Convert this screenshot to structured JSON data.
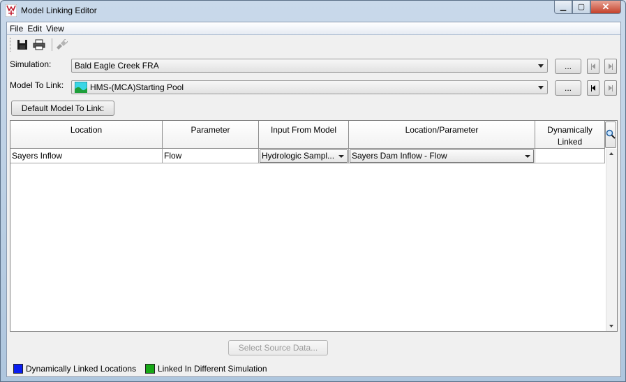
{
  "window": {
    "title": "Model Linking Editor"
  },
  "menubar": {
    "items": [
      "File",
      "Edit",
      "View"
    ]
  },
  "toolbar": {
    "icons": [
      "save-icon",
      "print-icon",
      "plugin-icon"
    ]
  },
  "simulation": {
    "label": "Simulation:",
    "value": "Bald Eagle Creek FRA",
    "browse_label": "..."
  },
  "model_to_link": {
    "label": "Model To Link:",
    "value": "HMS-(MCA)Starting Pool",
    "browse_label": "..."
  },
  "default_button": {
    "label": "Default Model To Link:"
  },
  "table": {
    "columns": [
      {
        "label": "Location"
      },
      {
        "label": "Parameter"
      },
      {
        "label": "Input From Model"
      },
      {
        "label": "Location/Parameter"
      },
      {
        "label": "Dynamically Linked"
      }
    ],
    "rows": [
      {
        "location": "Sayers Inflow",
        "parameter": "Flow",
        "input_from_model": "Hydrologic Sampl...",
        "location_parameter": "Sayers Dam Inflow - Flow",
        "dynamically_linked": ""
      }
    ]
  },
  "select_source_button": {
    "label": "Select Source Data..."
  },
  "legend": [
    {
      "label": "Dynamically Linked Locations",
      "color": "#0a1ef0"
    },
    {
      "label": "Linked In Different Simulation",
      "color": "#17a817"
    }
  ]
}
